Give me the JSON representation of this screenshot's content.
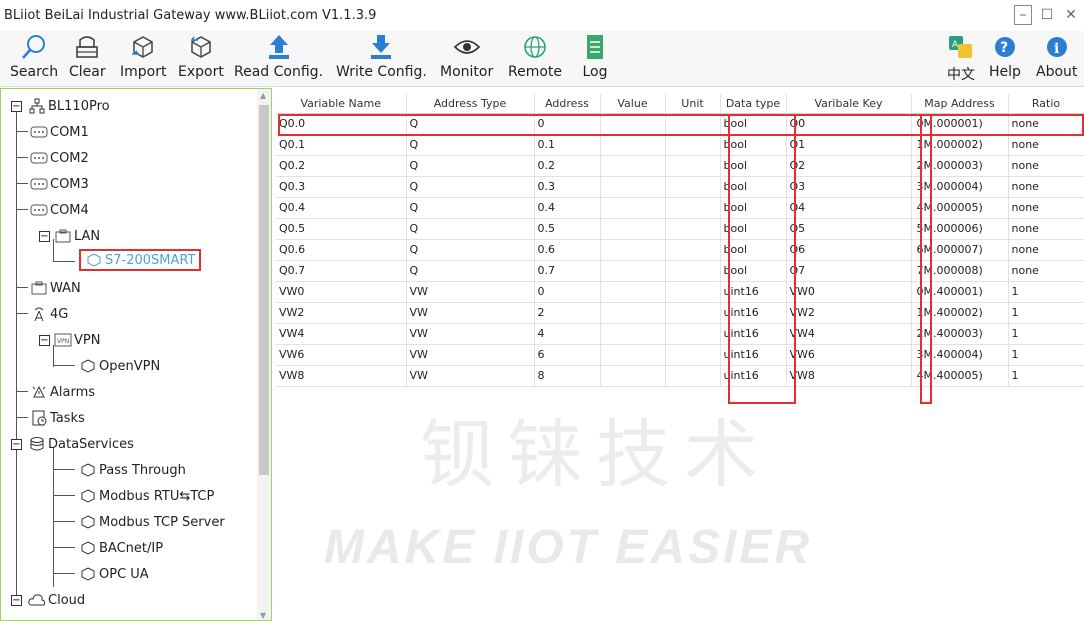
{
  "window": {
    "title": "BLiiot BeiLai Industrial Gateway www.BLiiot.com V1.1.3.9"
  },
  "toolbar": [
    {
      "label": "Search",
      "icon": "search-icon"
    },
    {
      "label": "Clear",
      "icon": "clear-icon"
    },
    {
      "label": "Import",
      "icon": "import-icon"
    },
    {
      "label": "Export",
      "icon": "export-icon"
    },
    {
      "label": "Read Config.",
      "icon": "upload-icon"
    },
    {
      "label": "Write Config.",
      "icon": "download-icon"
    },
    {
      "label": "Monitor",
      "icon": "eye-icon"
    },
    {
      "label": "Remote",
      "icon": "globe-icon"
    },
    {
      "label": "Log",
      "icon": "document-icon"
    },
    {
      "label": "中文",
      "icon": "language-icon"
    },
    {
      "label": "Help",
      "icon": "help-icon"
    },
    {
      "label": "About",
      "icon": "info-icon"
    }
  ],
  "tree": {
    "root": "BL110Pro",
    "com1": "COM1",
    "com2": "COM2",
    "com3": "COM3",
    "com4": "COM4",
    "lan": "LAN",
    "s7": "S7-200SMART",
    "wan": "WAN",
    "g4": "4G",
    "vpn": "VPN",
    "openvpn": "OpenVPN",
    "alarms": "Alarms",
    "tasks": "Tasks",
    "dataservices": "DataServices",
    "passthrough": "Pass Through",
    "modbusrtu": "Modbus RTU⇆TCP",
    "modbustcp": "Modbus TCP Server",
    "bacnet": "BACnet/IP",
    "opcua": "OPC UA",
    "cloud": "Cloud"
  },
  "table": {
    "columns": [
      "Variable Name",
      "Address Type",
      "Address",
      "Value",
      "Unit",
      "Data type",
      "Varibale Key",
      "Map Address",
      "Ratio"
    ],
    "rows": [
      [
        "Q0.0",
        "Q",
        "0",
        "",
        "",
        "bool",
        "Q0",
        "0",
        "M.000001)",
        "none"
      ],
      [
        "Q0.1",
        "Q",
        "0.1",
        "",
        "",
        "bool",
        "Q1",
        "1",
        "M.000002)",
        "none"
      ],
      [
        "Q0.2",
        "Q",
        "0.2",
        "",
        "",
        "bool",
        "Q2",
        "2",
        "M.000003)",
        "none"
      ],
      [
        "Q0.3",
        "Q",
        "0.3",
        "",
        "",
        "bool",
        "Q3",
        "3",
        "M.000004)",
        "none"
      ],
      [
        "Q0.4",
        "Q",
        "0.4",
        "",
        "",
        "bool",
        "Q4",
        "4",
        "M.000005)",
        "none"
      ],
      [
        "Q0.5",
        "Q",
        "0.5",
        "",
        "",
        "bool",
        "Q5",
        "5",
        "M.000006)",
        "none"
      ],
      [
        "Q0.6",
        "Q",
        "0.6",
        "",
        "",
        "bool",
        "Q6",
        "6",
        "M.000007)",
        "none"
      ],
      [
        "Q0.7",
        "Q",
        "0.7",
        "",
        "",
        "bool",
        "Q7",
        "7",
        "M.000008)",
        "none"
      ],
      [
        "VW0",
        "VW",
        "0",
        "",
        "",
        "uint16",
        "VW0",
        "0",
        "M.400001)",
        "1"
      ],
      [
        "VW2",
        "VW",
        "2",
        "",
        "",
        "uint16",
        "VW2",
        "1",
        "M.400002)",
        "1"
      ],
      [
        "VW4",
        "VW",
        "4",
        "",
        "",
        "uint16",
        "VW4",
        "2",
        "M.400003)",
        "1"
      ],
      [
        "VW6",
        "VW",
        "6",
        "",
        "",
        "uint16",
        "VW6",
        "3",
        "M.400004)",
        "1"
      ],
      [
        "VW8",
        "VW",
        "8",
        "",
        "",
        "uint16",
        "VW8",
        "4",
        "M.400005)",
        "1"
      ]
    ]
  },
  "watermark": {
    "cn": "钡铼技术",
    "en": "MAKE IIOT EASIER"
  },
  "colors": {
    "highlight": "#e03030",
    "tree_border": "#9ed36a",
    "selected_text": "#4aa3df"
  }
}
